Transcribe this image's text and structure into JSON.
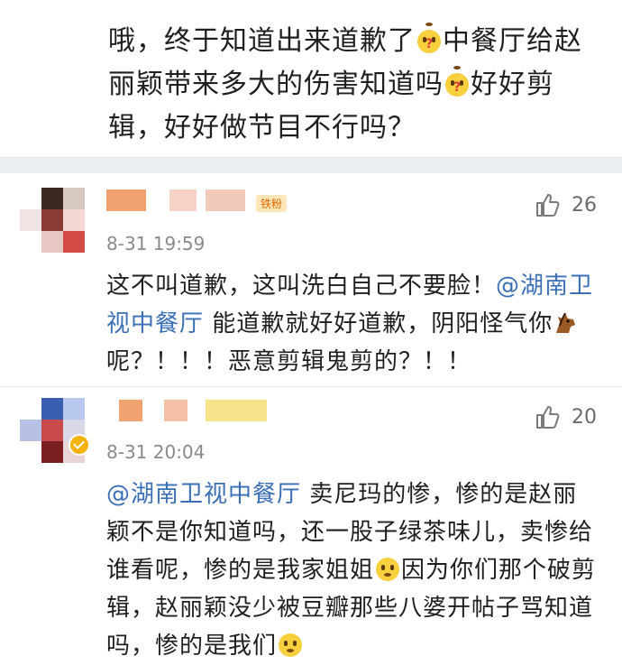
{
  "post": {
    "text_part1": "哦，终于知道出来道歉了",
    "text_part2": "中餐厅给赵丽颖带来多大的伤害知道吗",
    "text_part3": "好好剪辑，好好做节目不行吗？"
  },
  "comments": [
    {
      "badge": "铁粉",
      "time": "8-31 19:59",
      "likes": "26",
      "text_a": "这不叫道歉，这叫洗白自己不要脸！",
      "mention": "@湖南卫视中餐厅",
      "text_b": " 能道歉就好好道歉，阴阳怪气你",
      "text_c": "呢？！！！恶意剪辑鬼剪的？！！"
    },
    {
      "time": "8-31 20:04",
      "likes": "20",
      "mention": "@湖南卫视中餐厅",
      "text_a": " 卖尼玛的惨，惨的是赵丽颖不是你知道吗，还一股子绿茶味儿，卖惨给谁看呢，惨的是我家姐姐",
      "text_b": "因为你们那个破剪辑，赵丽颖没少被豆瓣那些八婆开帖子骂知道吗，惨的是我们"
    }
  ],
  "icons": {
    "like": "thumbs-up-icon",
    "verified": "verified-badge-icon",
    "horse": "horse-emoji-icon"
  }
}
